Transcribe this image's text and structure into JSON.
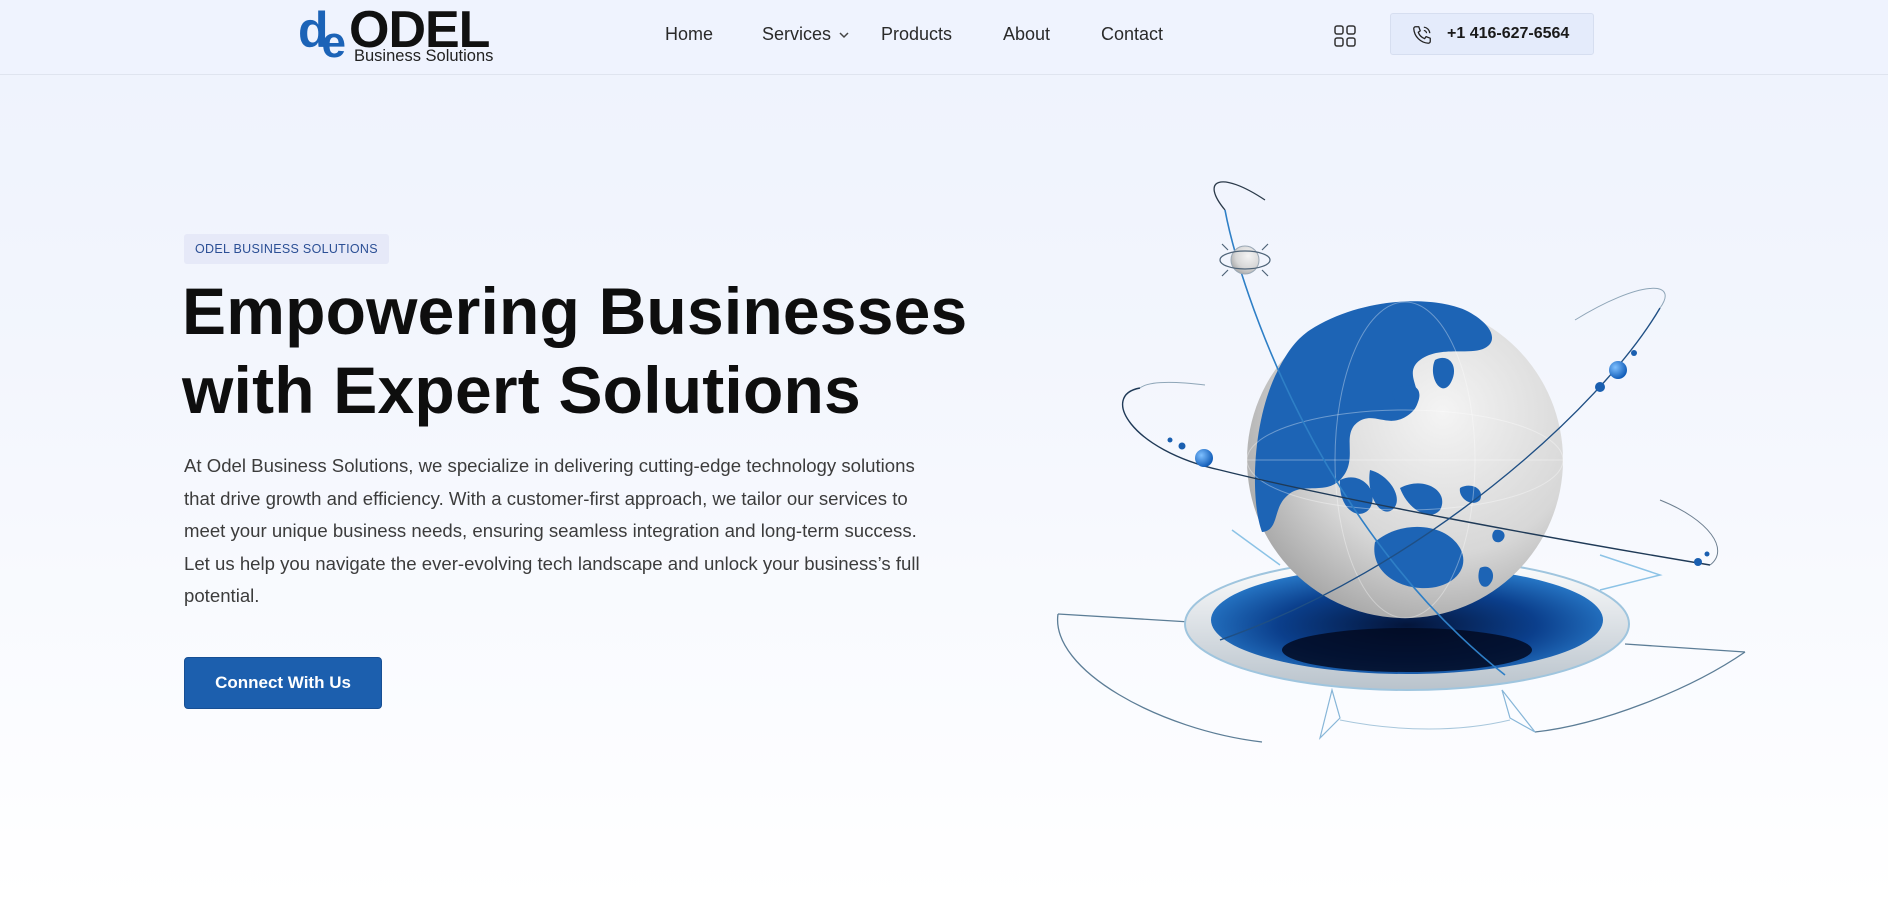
{
  "header": {
    "logo": {
      "mark_d": "d",
      "mark_e": "e",
      "wordmark": "ODEL",
      "subtitle": "Business Solutions"
    },
    "nav": [
      {
        "label": "Home"
      },
      {
        "label": "Services",
        "has_dropdown": true
      },
      {
        "label": "Products"
      },
      {
        "label": "About"
      },
      {
        "label": "Contact"
      }
    ],
    "apps_icon": "grid-icon",
    "phone": {
      "icon": "phone-icon",
      "number": "+1 416-627-6564"
    }
  },
  "hero": {
    "badge": "ODEL BUSINESS SOLUTIONS",
    "title_line1": "Empowering Businesses",
    "title_line2": "with Expert Solutions",
    "description": "At Odel Business Solutions, we specialize in delivering cutting-edge technology solutions that drive growth and efficiency. With a customer-first approach, we tailor our services to meet your unique business needs, ensuring seamless integration and long-term success. Let us help you navigate the ever-evolving tech landscape and unlock your business’s full potential.",
    "cta_label": "Connect With Us",
    "illustration": "globe-illustration"
  },
  "colors": {
    "brand": "#1c5fae",
    "logo_blue": "#1c63b7",
    "header_bg": "#eff3fe",
    "badge_bg": "#e6e9f8"
  }
}
